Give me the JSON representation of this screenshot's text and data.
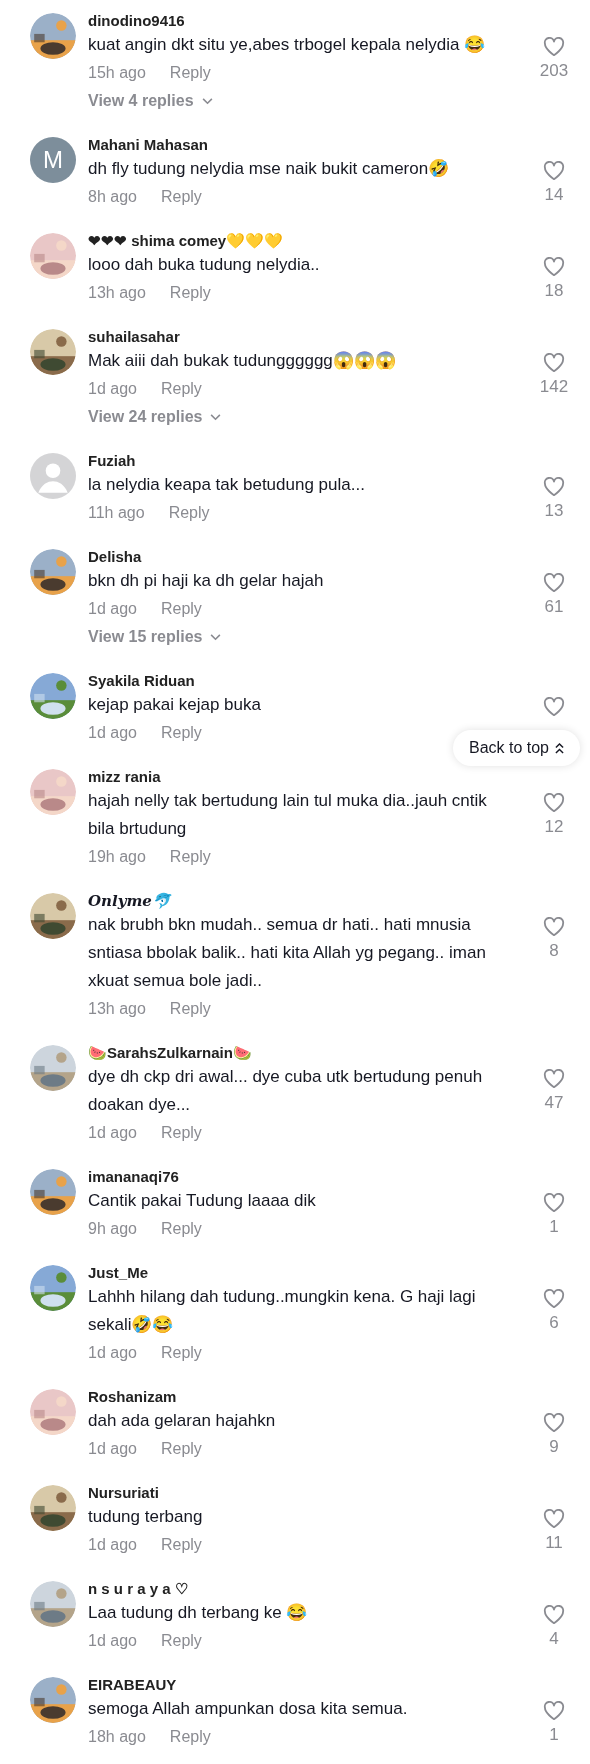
{
  "comments": [
    {
      "kind": "plain",
      "username": "dinodino9416",
      "text": "kuat angin dkt situ ye,abes trbogel kepala nelydia 😂",
      "time": "15h ago",
      "reply": "Reply",
      "likes": "203",
      "view_replies": "View 4 replies"
    },
    {
      "kind": "plain",
      "avatar": {
        "kind": "letter",
        "letter": "M"
      },
      "username": "Mahani Mahasan",
      "text": "dh fly tudung nelydia mse naik bukit cameron🤣",
      "time": "8h ago",
      "reply": "Reply",
      "likes": "14"
    },
    {
      "kind": "plain",
      "username": "❤❤❤ shima comey💛💛💛",
      "text": "looo dah buka tudung nelydia..",
      "time": "13h ago",
      "reply": "Reply",
      "likes": "18"
    },
    {
      "kind": "plain",
      "username": "suhailasahar",
      "text": "Mak aiii dah bukak tudungggggg😱😱😱",
      "time": "1d ago",
      "reply": "Reply",
      "likes": "142",
      "view_replies": "View 24 replies"
    },
    {
      "kind": "plain",
      "avatar": {
        "kind": "default"
      },
      "username": "Fuziah",
      "text": "la nelydia keapa tak betudung pula...",
      "time": "11h ago",
      "reply": "Reply",
      "likes": "13"
    },
    {
      "kind": "plain",
      "username": "Delisha",
      "text": "bkn dh pi haji ka dh gelar hajah",
      "time": "1d ago",
      "reply": "Reply",
      "likes": "61",
      "view_replies": "View 15 replies"
    },
    {
      "kind": "plain",
      "username": "Syakila Riduan",
      "text": "kejap pakai kejap buka",
      "time": "1d ago",
      "reply": "Reply",
      "back_to_top": "Back to top"
    },
    {
      "kind": "plain",
      "username": "mizz rania",
      "text": "hajah nelly tak bertudung lain tul muka dia..jauh cntik bila brtudung",
      "time": "19h ago",
      "reply": "Reply",
      "likes": "12"
    },
    {
      "kind": "serif",
      "username": "Onlyme🐬",
      "text": "nak brubh bkn mudah.. semua dr hati.. hati mnusia sntiasa bbolak balik.. hati kita Allah yg pegang.. iman xkuat semua bole jadi..",
      "time": "13h ago",
      "reply": "Reply",
      "likes": "8"
    },
    {
      "kind": "plain",
      "username": "🍉SarahsZulkarnain🍉",
      "text": "dye dh ckp dri awal... dye cuba utk bertudung penuh doakan dye...",
      "time": "1d ago",
      "reply": "Reply",
      "likes": "47"
    },
    {
      "kind": "plain",
      "username": "imananaqi76",
      "text": "Cantik pakai Tudung laaaa dik",
      "time": "9h ago",
      "reply": "Reply",
      "likes": "1"
    },
    {
      "kind": "plain",
      "username": "Just_Me",
      "text": "Lahhh hilang dah tudung..mungkin kena. G haji lagi sekali🤣😂",
      "time": "1d ago",
      "reply": "Reply",
      "likes": "6"
    },
    {
      "kind": "plain",
      "username": "Roshanizam",
      "text": "dah ada gelaran hajahkn",
      "time": "1d ago",
      "reply": "Reply",
      "likes": "9"
    },
    {
      "kind": "plain",
      "username": "Nursuriati",
      "text": "tudung terbang",
      "time": "1d ago",
      "reply": "Reply",
      "likes": "11"
    },
    {
      "kind": "plain",
      "username": "n s u r a y a ♡",
      "text": "Laa tudung dh terbang ke 😂",
      "time": "1d ago",
      "reply": "Reply",
      "likes": "4"
    },
    {
      "kind": "plain",
      "username": "EIRABEAUY",
      "text": "semoga Allah ampunkan dosa kita semua.",
      "time": "18h ago",
      "reply": "Reply",
      "likes": "1"
    }
  ]
}
